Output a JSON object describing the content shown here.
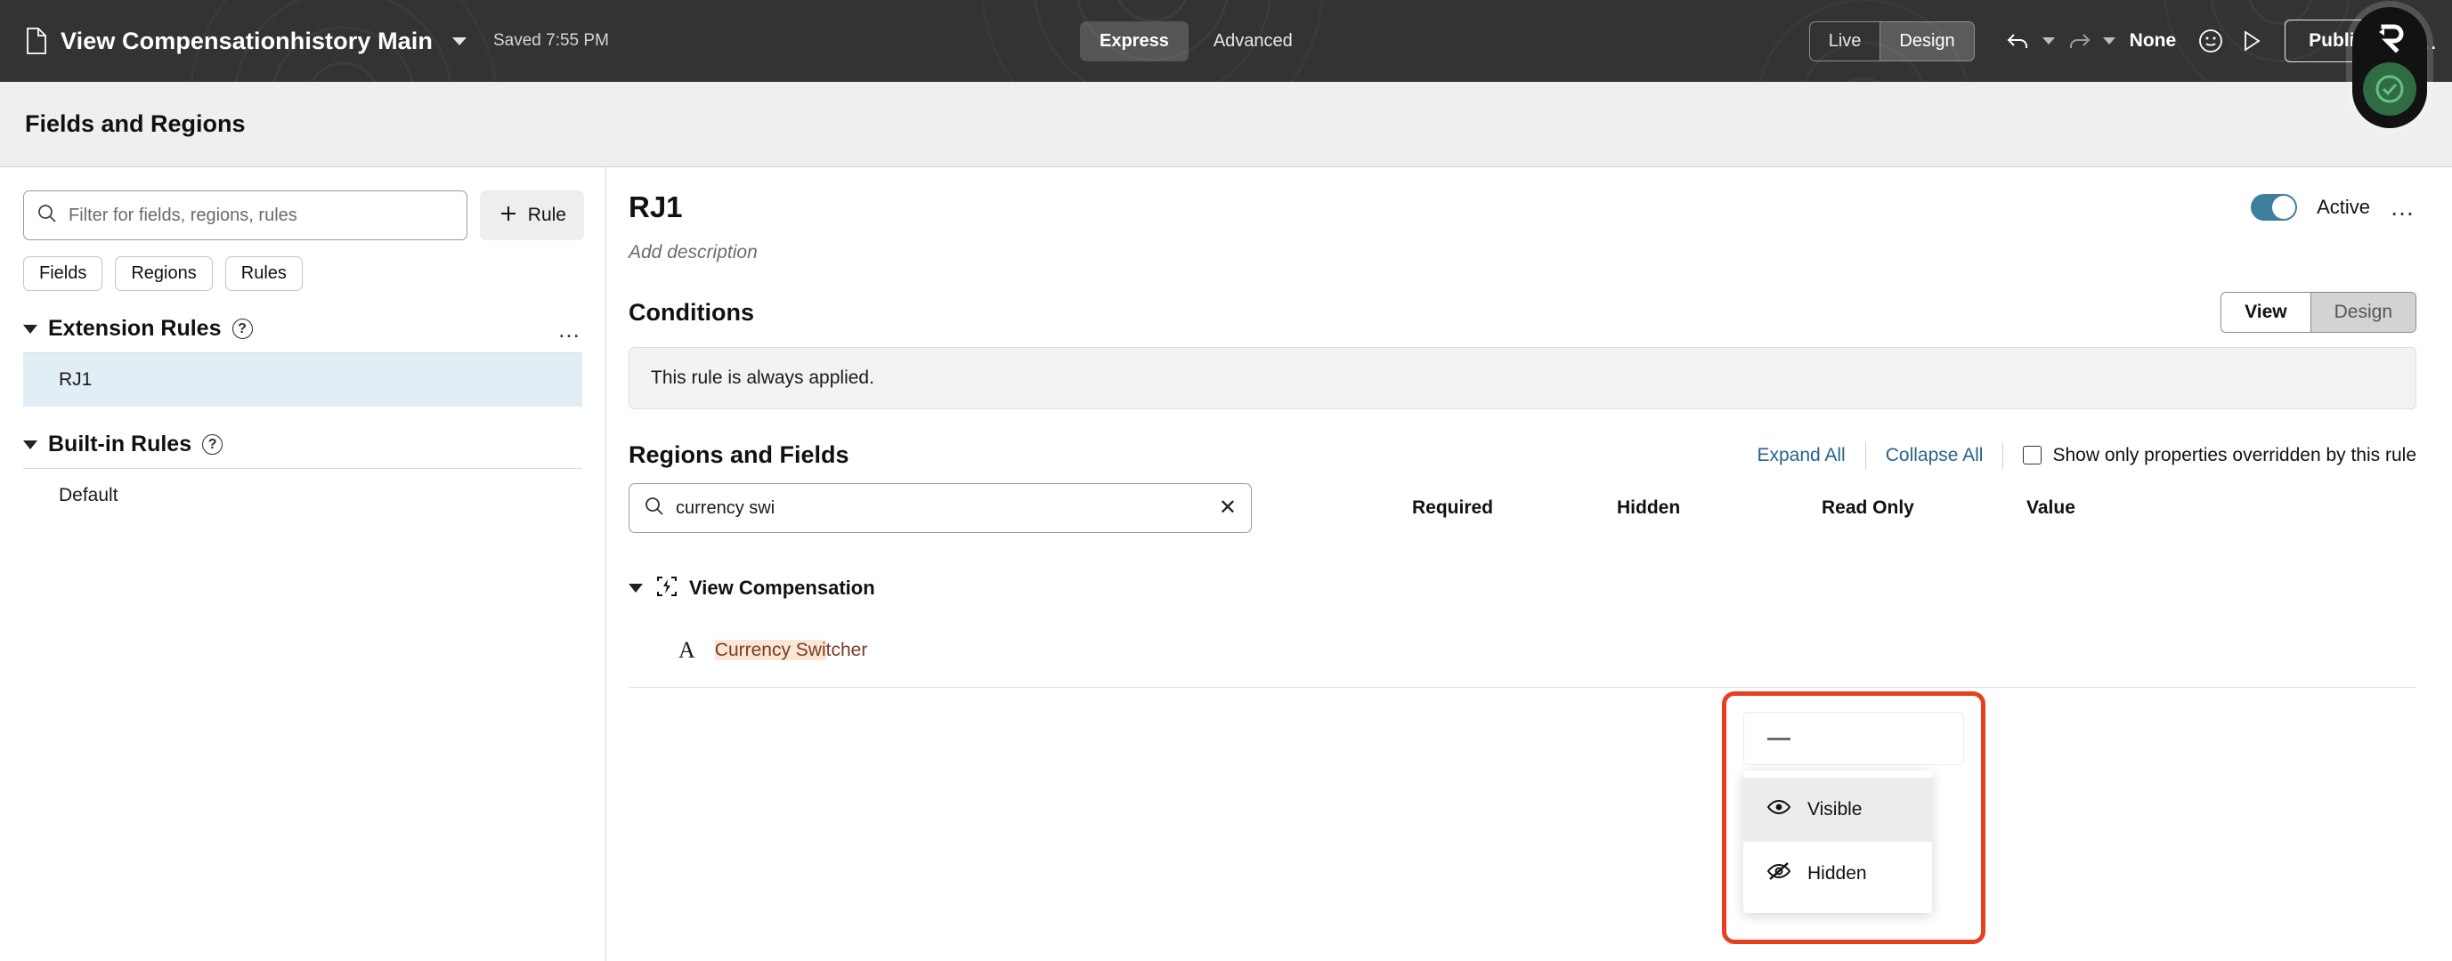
{
  "topbar": {
    "doc_icon": "document-icon",
    "doc_title": "View Compensationhistory Main",
    "title_caret": "chevron-down-icon",
    "saved_status": "Saved 7:55 PM",
    "mode_tabs": [
      {
        "label": "Express",
        "active": true
      },
      {
        "label": "Advanced",
        "active": false
      }
    ],
    "preview_seg": [
      {
        "label": "Live",
        "active": false
      },
      {
        "label": "Design",
        "active": true
      }
    ],
    "undo_icon": "undo-icon",
    "undo_caret": "chevron-down-icon",
    "redo_icon": "redo-icon",
    "redo_caret": "chevron-down-icon",
    "none_label": "None",
    "smiley_icon": "smiley-face-icon",
    "play_icon": "play-preview-icon",
    "publish_label": "Publish",
    "overflow": "…",
    "recorder": {
      "logo_icon": "recorder-r-logo-icon",
      "status_icon": "check-circle-icon",
      "status_color": "#2f6b43"
    }
  },
  "subheader": {
    "title": "Fields and Regions"
  },
  "sidebar": {
    "filter_placeholder": "Filter for fields, regions, rules",
    "filter_value": "",
    "search_icon": "search-icon",
    "add_rule": {
      "icon": "plus-icon",
      "label": "Rule"
    },
    "chips": [
      {
        "label": "Fields"
      },
      {
        "label": "Regions"
      },
      {
        "label": "Rules"
      }
    ],
    "sections": [
      {
        "title": "Extension Rules",
        "help_icon": "help-circle-icon",
        "overflow": "…",
        "items": [
          {
            "label": "RJ1",
            "selected": true
          }
        ]
      },
      {
        "title": "Built-in Rules",
        "help_icon": "help-circle-icon",
        "items": [
          {
            "label": "Default",
            "selected": false
          }
        ]
      }
    ]
  },
  "main": {
    "title": "RJ1",
    "active_toggle": {
      "label": "Active",
      "on": true,
      "color": "#3f7f9e"
    },
    "overflow": "…",
    "description_placeholder": "Add description",
    "conditions": {
      "heading": "Conditions",
      "view_design": [
        {
          "label": "View",
          "active": true
        },
        {
          "label": "Design",
          "active": false
        }
      ],
      "message": "This rule is always applied."
    },
    "regions_and_fields": {
      "heading": "Regions and Fields",
      "expand_all": "Expand All",
      "collapse_all": "Collapse All",
      "show_overridden": {
        "label": "Show only properties overridden by this rule",
        "checked": false
      },
      "search": {
        "value": "currency swi",
        "icon": "search-icon",
        "clear_icon": "clear-x-icon"
      },
      "columns": [
        "Required",
        "Hidden",
        "Read Only",
        "Value"
      ],
      "rows": [
        {
          "type": "region",
          "icon": "region-lightning-icon",
          "label": "View Compensation",
          "expanded": true
        },
        {
          "type": "field",
          "icon": "text-field-a-icon",
          "label_highlight": "Currency Swi",
          "label_rest": "tcher",
          "hidden_value": "—"
        }
      ]
    }
  },
  "dropdown": {
    "annotation_color": "#e8401f",
    "selected_display": "—",
    "options": [
      {
        "label": "Visible",
        "icon": "eye-icon",
        "hovered": true
      },
      {
        "label": "Hidden",
        "icon": "eye-off-icon",
        "hovered": false
      }
    ]
  }
}
